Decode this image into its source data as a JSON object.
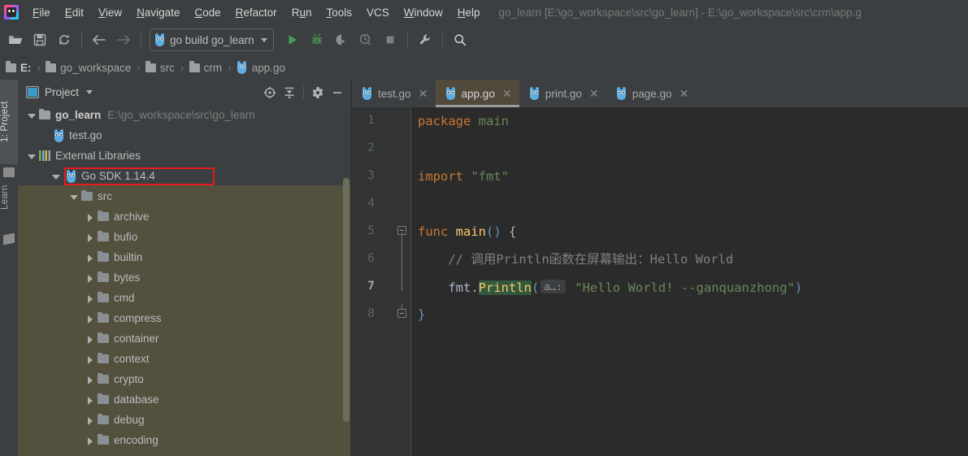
{
  "window": {
    "title": "go_learn [E:\\go_workspace\\src\\go_learn] - E:\\go_workspace\\src\\crm\\app.g",
    "logo_icon": "goland-logo-icon"
  },
  "menu": {
    "items": [
      {
        "mnemonic": "F",
        "rest": "ile"
      },
      {
        "mnemonic": "E",
        "rest": "dit"
      },
      {
        "mnemonic": "V",
        "rest": "iew"
      },
      {
        "mnemonic": "N",
        "rest": "avigate"
      },
      {
        "mnemonic": "C",
        "rest": "ode"
      },
      {
        "mnemonic": "R",
        "rest": "efactor"
      },
      {
        "mnemonic": "u",
        "rest": "",
        "pre": "R",
        "post": "n",
        "label": "Run"
      },
      {
        "mnemonic": "T",
        "rest": "ools"
      },
      {
        "mnemonic": "",
        "rest": "VCS",
        "label": "VCS"
      },
      {
        "mnemonic": "W",
        "rest": "indow"
      },
      {
        "mnemonic": "H",
        "rest": "elp"
      }
    ],
    "labels": [
      "File",
      "Edit",
      "View",
      "Navigate",
      "Code",
      "Refactor",
      "Run",
      "Tools",
      "VCS",
      "Window",
      "Help"
    ]
  },
  "toolbar": {
    "icons": [
      "open-folder-icon",
      "save-all-icon",
      "sync-refresh-icon",
      "back-arrow-icon",
      "forward-arrow-icon"
    ],
    "run_config": {
      "label": "go build go_learn",
      "icon": "go-gopher-icon",
      "dropdown_icon": "chevron-down-icon"
    },
    "action_icons": [
      "run-icon",
      "debug-icon",
      "run-with-coverage-icon",
      "profile-icon",
      "stop-icon",
      "settings-wrench-icon",
      "search-icon"
    ],
    "colors": {
      "run_green": "#499c54",
      "debug_green": "#4d9c52"
    }
  },
  "breadcrumb": {
    "items": [
      {
        "label": "E:",
        "icon": "folder-icon",
        "bold": true
      },
      {
        "label": "go_workspace",
        "icon": "folder-icon",
        "bold": false
      },
      {
        "label": "src",
        "icon": "folder-icon",
        "bold": false
      },
      {
        "label": "crm",
        "icon": "folder-icon",
        "bold": false
      },
      {
        "label": "app.go",
        "icon": "go-gopher-icon",
        "bold": false
      }
    ],
    "separator": "›"
  },
  "left_tool_tabs": [
    {
      "label": "1: Project",
      "active": true,
      "icon": "project-tab-icon"
    },
    {
      "label": "Learn",
      "active": false,
      "icon": "learn-tab-icon"
    }
  ],
  "project_panel": {
    "title": "Project",
    "title_caret_icon": "chevron-down-icon",
    "icon": "project-window-icon",
    "actions": [
      {
        "name": "scroll-from-source-icon",
        "label": "Select Opened File"
      },
      {
        "name": "collapse-all-icon",
        "label": "Collapse All"
      },
      {
        "name": "gear-icon",
        "label": "Settings"
      },
      {
        "name": "minimize-icon",
        "label": "Hide"
      }
    ],
    "highlight_color": "#e81c1c",
    "selection_color": "#53503e",
    "tree": [
      {
        "depth": 0,
        "label": "go_learn",
        "path": "E:\\go_workspace\\src\\go_learn",
        "icon": "folder-icon",
        "twisty": "down",
        "bold": true,
        "selected": false
      },
      {
        "depth": 1,
        "label": "test.go",
        "path": "",
        "icon": "go-gopher-icon",
        "twisty": "none",
        "bold": false,
        "selected": false
      },
      {
        "depth": 0,
        "label": "External Libraries",
        "path": "",
        "icon": "libraries-icon",
        "twisty": "down",
        "bold": false,
        "selected": false
      },
      {
        "depth": 1,
        "label": "Go SDK 1.14.4",
        "path": "",
        "icon": "go-gopher-icon",
        "twisty": "down",
        "bold": false,
        "selected": false,
        "highlighted": true
      },
      {
        "depth": 2,
        "label": "src",
        "path": "",
        "icon": "folder-icon",
        "twisty": "down",
        "bold": false,
        "selected": true
      },
      {
        "depth": 3,
        "label": "archive",
        "path": "",
        "icon": "folder-icon",
        "twisty": "right",
        "bold": false,
        "selected": true
      },
      {
        "depth": 3,
        "label": "bufio",
        "path": "",
        "icon": "folder-icon",
        "twisty": "right",
        "bold": false,
        "selected": true
      },
      {
        "depth": 3,
        "label": "builtin",
        "path": "",
        "icon": "folder-icon",
        "twisty": "right",
        "bold": false,
        "selected": true
      },
      {
        "depth": 3,
        "label": "bytes",
        "path": "",
        "icon": "folder-icon",
        "twisty": "right",
        "bold": false,
        "selected": true
      },
      {
        "depth": 3,
        "label": "cmd",
        "path": "",
        "icon": "folder-icon",
        "twisty": "right",
        "bold": false,
        "selected": true
      },
      {
        "depth": 3,
        "label": "compress",
        "path": "",
        "icon": "folder-icon",
        "twisty": "right",
        "bold": false,
        "selected": true
      },
      {
        "depth": 3,
        "label": "container",
        "path": "",
        "icon": "folder-icon",
        "twisty": "right",
        "bold": false,
        "selected": true
      },
      {
        "depth": 3,
        "label": "context",
        "path": "",
        "icon": "folder-icon",
        "twisty": "right",
        "bold": false,
        "selected": true
      },
      {
        "depth": 3,
        "label": "crypto",
        "path": "",
        "icon": "folder-icon",
        "twisty": "right",
        "bold": false,
        "selected": true
      },
      {
        "depth": 3,
        "label": "database",
        "path": "",
        "icon": "folder-icon",
        "twisty": "right",
        "bold": false,
        "selected": true
      },
      {
        "depth": 3,
        "label": "debug",
        "path": "",
        "icon": "folder-icon",
        "twisty": "right",
        "bold": false,
        "selected": true
      },
      {
        "depth": 3,
        "label": "encoding",
        "path": "",
        "icon": "folder-icon",
        "twisty": "right",
        "bold": false,
        "selected": true
      }
    ]
  },
  "editor": {
    "tabs": [
      {
        "label": "test.go",
        "active": false,
        "icon": "go-gopher-icon",
        "close_icon": "close-icon"
      },
      {
        "label": "app.go",
        "active": true,
        "icon": "go-gopher-icon",
        "close_icon": "close-icon"
      },
      {
        "label": "print.go",
        "active": false,
        "icon": "go-gopher-icon",
        "close_icon": "close-icon"
      },
      {
        "label": "page.go",
        "active": false,
        "icon": "go-gopher-icon",
        "close_icon": "close-icon"
      }
    ],
    "active_tab_bg": "#51493a",
    "background": "#2b2b2b",
    "gutter_background": "#313335",
    "line_numbers": [
      "1",
      "2",
      "3",
      "4",
      "5",
      "6",
      "7",
      "8"
    ],
    "caret_line": 7,
    "lines": [
      {
        "n": 1,
        "tokens": [
          {
            "t": "package ",
            "c": "k"
          },
          {
            "t": "main",
            "c": "str"
          }
        ]
      },
      {
        "n": 2,
        "tokens": []
      },
      {
        "n": 3,
        "tokens": [
          {
            "t": "import ",
            "c": "k"
          },
          {
            "t": "\"fmt\"",
            "c": "str"
          }
        ]
      },
      {
        "n": 4,
        "tokens": []
      },
      {
        "n": 5,
        "tokens": [
          {
            "t": "func ",
            "c": "k"
          },
          {
            "t": "main",
            "c": "fn"
          },
          {
            "t": "()",
            "c": "br"
          },
          {
            "t": " {",
            "c": "plain"
          }
        ]
      },
      {
        "n": 6,
        "tokens": [
          {
            "t": "    // 调用Println函数在屏幕输出：Hello World",
            "c": "cmt"
          }
        ]
      },
      {
        "n": 7,
        "tokens": [
          {
            "t": "    fmt",
            "c": "plain"
          },
          {
            "t": ".",
            "c": "plain"
          },
          {
            "t": "Println",
            "c": "fn-hl"
          },
          {
            "t": "(",
            "c": "br"
          },
          {
            "t": "a…:",
            "c": "hint"
          },
          {
            "t": " \"Hello World! --ganquanzhong\"",
            "c": "str"
          },
          {
            "t": ")",
            "c": "br"
          }
        ]
      },
      {
        "n": 8,
        "tokens": [
          {
            "t": "}",
            "c": "br"
          }
        ]
      }
    ],
    "syntax_colors": {
      "keyword": "#cc7832",
      "string": "#6a8759",
      "function": "#ffc66d",
      "bracket": "#6897bb",
      "comment": "#808080",
      "default": "#a9b7c6",
      "usage_highlight": "#32593d"
    },
    "parameter_hint": "a…:",
    "fold_markers": [
      {
        "line": 5,
        "type": "collapse"
      },
      {
        "line": 8,
        "type": "collapse-end"
      }
    ]
  }
}
